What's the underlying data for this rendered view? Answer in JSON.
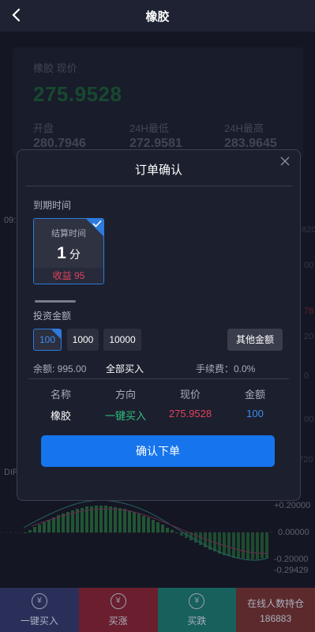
{
  "header": {
    "title": "橡胶"
  },
  "background": {
    "price_label": "橡胶 现价",
    "price": "275.9528",
    "stats": [
      {
        "label": "开盘",
        "value": "280.7946"
      },
      {
        "label": "24H最低",
        "value": "272.9581"
      },
      {
        "label": "24H最高",
        "value": "283.9645"
      }
    ],
    "time_label": "09:",
    "indicator_label": "DIF",
    "axis_labels": [
      "820",
      "00",
      "78",
      "20",
      "0",
      "00",
      "720"
    ],
    "macd_axis": [
      "+0.20000",
      "0.00000",
      "-0.20000",
      "-0.29429"
    ]
  },
  "modal": {
    "title": "订单确认",
    "expiry_label": "到期时间",
    "expiry": {
      "caption": "结算时间",
      "number": "1",
      "unit": "分",
      "profit": "收益 95"
    },
    "amount_label": "投资金额",
    "amounts": [
      "100",
      "1000",
      "10000"
    ],
    "other_amount": "其他金额",
    "balance": "余额: 995.00",
    "buy_all": "全部买入",
    "fee": "手续费：0.0%",
    "table_headers": [
      "名称",
      "方向",
      "现价",
      "金额"
    ],
    "table_row": [
      "橡胶",
      "一键买入",
      "275.9528",
      "100"
    ],
    "confirm": "确认下单"
  },
  "bottom_bar": [
    {
      "icon": "¥",
      "label": "一键买入",
      "color": "#2a2f5a"
    },
    {
      "icon": "¥",
      "label": "买涨",
      "color": "#6b1f2e"
    },
    {
      "icon": "¥",
      "label": "买跌",
      "color": "#17605c"
    },
    {
      "icon": "",
      "label": "在线人数持仓",
      "value": "186883",
      "color": "#5c2a2c"
    }
  ],
  "colors": {
    "accent": "#1674ec",
    "up": "#e2425a",
    "down": "#2ec27e"
  }
}
